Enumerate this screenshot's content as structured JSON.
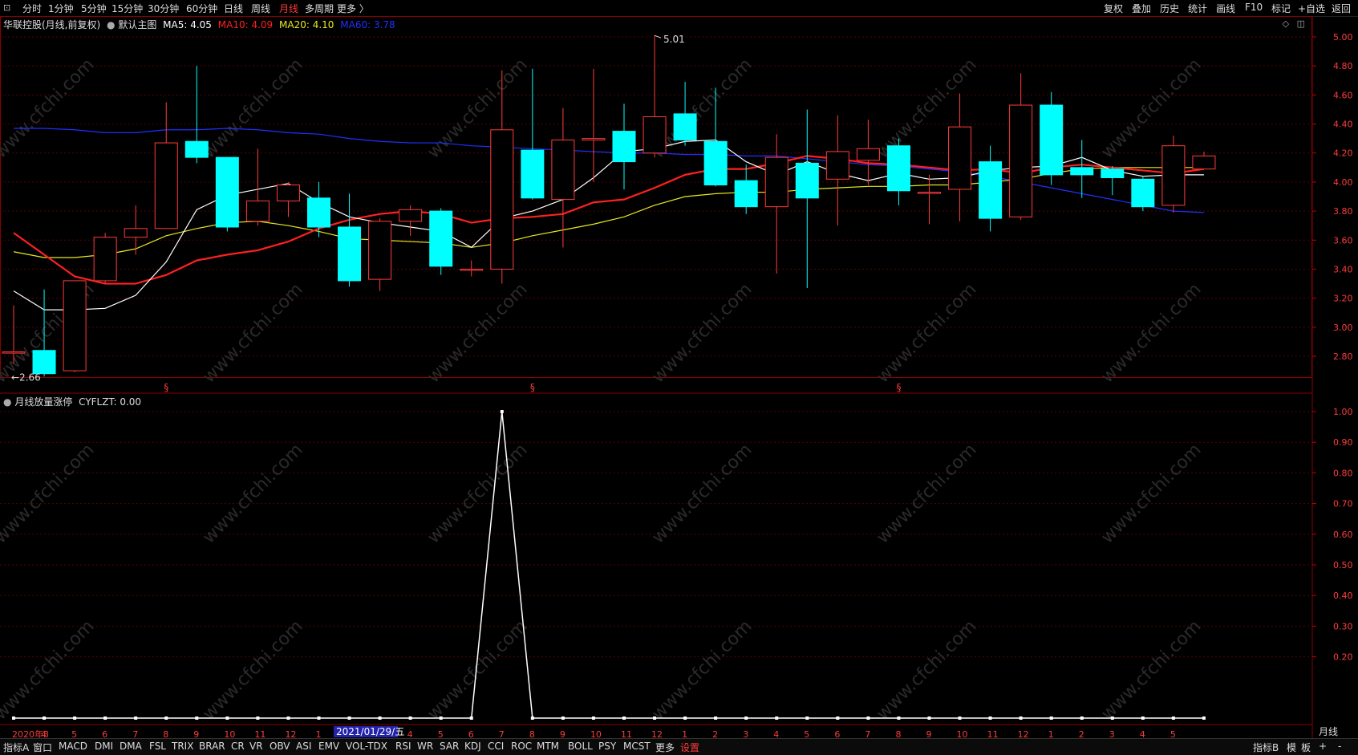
{
  "topbar": {
    "periods": [
      "分时",
      "1分钟",
      "5分钟",
      "15分钟",
      "30分钟",
      "60分钟",
      "日线",
      "周线",
      "月线",
      "多周期",
      "更多 〉"
    ],
    "active_period": "月线",
    "right_items": [
      "复权",
      "叠加",
      "历史",
      "统计",
      "画线",
      "F10",
      "标记",
      "+自选",
      "返回"
    ]
  },
  "main_legend": {
    "title": "华联控股(月线,前复权)",
    "main_chart_label": "默认主图",
    "ma5": "MA5: 4.05",
    "ma10": "MA10: 4.09",
    "ma20": "MA20: 4.10",
    "ma60": "MA60: 3.78",
    "colors": {
      "ma5": "#ffffff",
      "ma10": "#ff2020",
      "ma20": "#e8e820",
      "ma60": "#2030ff",
      "up": "#ff3b3b",
      "down": "#00ffff"
    }
  },
  "annotations": {
    "high_label": "5.01",
    "low_label": "2.66",
    "event_marker": "§"
  },
  "sub_legend": {
    "title": "月线放量涨停",
    "value": "CYFLZT: 0.00"
  },
  "price_ticks": [
    "5.00",
    "4.80",
    "4.60",
    "4.40",
    "4.20",
    "4.00",
    "3.80",
    "3.60",
    "3.40",
    "3.20",
    "3.00",
    "2.80"
  ],
  "sub_ticks": [
    "1.00",
    "0.90",
    "0.80",
    "0.70",
    "0.60",
    "0.50",
    "0.40",
    "0.30",
    "0.20"
  ],
  "x_labels": [
    "2020年3",
    "4",
    "5",
    "6",
    "7",
    "8",
    "9",
    "10",
    "11",
    "12",
    "1",
    "2",
    "3",
    "4",
    "5",
    "6",
    "7",
    "8",
    "9",
    "10",
    "11",
    "12",
    "1",
    "2",
    "3",
    "4",
    "5",
    "6",
    "7",
    "8",
    "9",
    "10",
    "11",
    "12",
    "1",
    "2",
    "3",
    "4",
    "5"
  ],
  "cursor_date": "2021/01/29/五",
  "period_corner_label": "月线",
  "bottombar": {
    "tabs": [
      "指标A",
      "窗口",
      "MACD",
      "DMI",
      "DMA",
      "FSL",
      "TRIX",
      "BRAR",
      "CR",
      "VR",
      "OBV",
      "ASI",
      "EMV",
      "VOL-TDX",
      "RSI",
      "WR",
      "SAR",
      "KDJ",
      "CCI",
      "ROC",
      "MTM",
      "BOLL",
      "PSY",
      "MCST",
      "更多",
      "设置"
    ],
    "right": [
      "指标B",
      "模",
      "板",
      "+",
      "-"
    ]
  },
  "watermark": "www.cfchi.com",
  "chart_data": {
    "type": "candlestick",
    "categories": [
      "2020-03",
      "2020-04",
      "2020-05",
      "2020-06",
      "2020-07",
      "2020-08",
      "2020-09",
      "2020-10",
      "2020-11",
      "2020-12",
      "2021-01",
      "2021-02",
      "2021-03",
      "2021-04",
      "2021-05",
      "2021-06",
      "2021-07",
      "2021-08",
      "2021-09",
      "2021-10",
      "2021-11",
      "2021-12",
      "2022-01",
      "2022-02",
      "2022-03",
      "2022-04",
      "2022-05",
      "2022-06",
      "2022-07",
      "2022-08",
      "2022-09",
      "2022-10",
      "2022-11",
      "2022-12",
      "2023-01",
      "2023-02",
      "2023-03",
      "2023-04",
      "2023-05"
    ],
    "ohlc": [
      [
        2.83,
        3.15,
        2.75,
        2.83
      ],
      [
        2.84,
        3.26,
        2.66,
        2.68
      ],
      [
        2.7,
        3.32,
        2.69,
        3.32
      ],
      [
        3.32,
        3.65,
        3.3,
        3.62
      ],
      [
        3.62,
        3.84,
        3.5,
        3.68
      ],
      [
        3.68,
        4.55,
        3.68,
        4.27
      ],
      [
        4.28,
        4.8,
        4.13,
        4.17
      ],
      [
        4.17,
        4.17,
        3.66,
        3.69
      ],
      [
        3.73,
        4.23,
        3.7,
        3.87
      ],
      [
        3.87,
        4.0,
        3.76,
        3.98
      ],
      [
        3.89,
        4.0,
        3.62,
        3.69
      ],
      [
        3.69,
        3.92,
        3.28,
        3.32
      ],
      [
        3.33,
        3.75,
        3.25,
        3.73
      ],
      [
        3.73,
        3.84,
        3.63,
        3.81
      ],
      [
        3.8,
        3.82,
        3.36,
        3.42
      ],
      [
        3.4,
        3.46,
        3.35,
        3.4
      ],
      [
        3.4,
        4.77,
        3.3,
        4.36
      ],
      [
        4.22,
        4.78,
        3.88,
        3.89
      ],
      [
        3.88,
        4.51,
        3.55,
        4.29
      ],
      [
        4.29,
        4.78,
        4.0,
        4.3
      ],
      [
        4.35,
        4.54,
        3.95,
        4.14
      ],
      [
        4.2,
        5.01,
        4.17,
        4.45
      ],
      [
        4.47,
        4.69,
        4.25,
        4.29
      ],
      [
        4.28,
        4.65,
        3.97,
        3.98
      ],
      [
        4.01,
        4.12,
        3.78,
        3.83
      ],
      [
        3.83,
        4.33,
        3.37,
        4.17
      ],
      [
        4.13,
        4.5,
        3.27,
        3.89
      ],
      [
        4.02,
        4.46,
        3.7,
        4.21
      ],
      [
        4.15,
        4.43,
        3.98,
        4.23
      ],
      [
        4.25,
        4.3,
        3.84,
        3.94
      ],
      [
        3.93,
        4.05,
        3.71,
        3.93
      ],
      [
        3.95,
        4.61,
        3.73,
        4.38
      ],
      [
        4.14,
        4.25,
        3.66,
        3.75
      ],
      [
        3.76,
        4.75,
        3.74,
        4.53
      ],
      [
        4.53,
        4.62,
        3.98,
        4.05
      ],
      [
        4.1,
        4.29,
        3.89,
        4.05
      ],
      [
        4.09,
        4.11,
        3.91,
        4.03
      ],
      [
        4.02,
        4.04,
        3.8,
        3.83
      ],
      [
        3.84,
        4.32,
        3.79,
        4.25
      ],
      [
        4.09,
        4.21,
        4.09,
        4.18
      ]
    ],
    "ma5": [
      3.25,
      3.12,
      3.12,
      3.13,
      3.22,
      3.45,
      3.81,
      3.91,
      3.95,
      3.99,
      3.86,
      3.76,
      3.72,
      3.69,
      3.66,
      3.55,
      3.75,
      3.8,
      3.88,
      4.03,
      4.21,
      4.23,
      4.28,
      4.29,
      4.14,
      4.05,
      4.14,
      4.06,
      4.01,
      4.06,
      4.02,
      4.03,
      4.08,
      4.1,
      4.11,
      4.17,
      4.08,
      4.04,
      4.05,
      4.05
    ],
    "ma10": [
      3.65,
      3.5,
      3.35,
      3.3,
      3.3,
      3.36,
      3.46,
      3.5,
      3.53,
      3.59,
      3.68,
      3.74,
      3.78,
      3.8,
      3.78,
      3.72,
      3.75,
      3.76,
      3.78,
      3.86,
      3.88,
      3.96,
      4.05,
      4.09,
      4.09,
      4.13,
      4.18,
      4.16,
      4.13,
      4.12,
      4.1,
      4.08,
      4.09,
      4.06,
      4.1,
      4.12,
      4.1,
      4.08,
      4.06,
      4.09
    ],
    "ma20": [
      3.52,
      3.48,
      3.48,
      3.5,
      3.54,
      3.63,
      3.68,
      3.72,
      3.73,
      3.7,
      3.66,
      3.61,
      3.6,
      3.59,
      3.58,
      3.55,
      3.58,
      3.63,
      3.67,
      3.71,
      3.76,
      3.84,
      3.9,
      3.92,
      3.93,
      3.93,
      3.95,
      3.96,
      3.97,
      3.97,
      3.98,
      3.98,
      4.0,
      4.02,
      4.06,
      4.09,
      4.1,
      4.1,
      4.1,
      4.1
    ],
    "ma60": [
      4.37,
      4.37,
      4.36,
      4.34,
      4.34,
      4.36,
      4.36,
      4.37,
      4.36,
      4.34,
      4.33,
      4.3,
      4.28,
      4.27,
      4.27,
      4.25,
      4.24,
      4.23,
      4.22,
      4.21,
      4.2,
      4.2,
      4.19,
      4.19,
      4.18,
      4.18,
      4.16,
      4.14,
      4.12,
      4.11,
      4.09,
      4.07,
      4.04,
      4.0,
      3.96,
      3.92,
      3.88,
      3.84,
      3.8,
      3.79
    ],
    "indicator": {
      "name": "CYFLZT",
      "values": [
        0,
        0,
        0,
        0,
        0,
        0,
        0,
        0,
        0,
        0,
        0,
        0,
        0,
        0,
        0,
        0,
        1,
        0,
        0,
        0,
        0,
        0,
        0,
        0,
        0,
        0,
        0,
        0,
        0,
        0,
        0,
        0,
        0,
        0,
        0,
        0,
        0,
        0,
        0,
        0
      ]
    },
    "price_range": [
      2.6,
      5.03
    ],
    "indicator_range": [
      0,
      1.05
    ],
    "grid": true
  }
}
